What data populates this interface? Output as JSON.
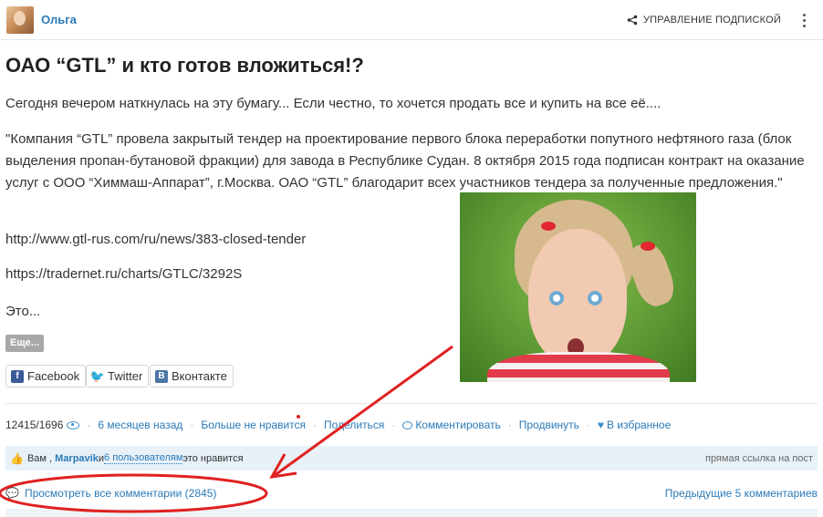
{
  "header": {
    "author_name": "Ольга",
    "subscription_label": "УПРАВЛЕНИЕ ПОДПИСКОЙ",
    "icons": {
      "share": "share-icon",
      "menu": "kebab-menu-icon"
    }
  },
  "post": {
    "title": "ОАО “GTL” и кто  готов вложиться!?",
    "intro": "Сегодня вечером наткнулась на эту бумагу... Если честно, то хочется продать все и купить на все её....",
    "quote": "\"Компания “GTL” провела закрытый тендер на проектирование первого блока переработки попутного нефтяного газа (блок выделения пропан-бутановой фракции) для завода в Республике Судан. 8 октября 2015 года подписан контракт на оказание услуг с ООО “Химмаш-Аппарат”, г.Москва. ОАО “GTL” благодарит всех участников тендера за полученные предложения.\"",
    "link1": "http://www.gtl-rus.com/ru/news/383-closed-tender",
    "link2": "https://tradernet.ru/charts/GTLC/3292S",
    "ending": "Это...",
    "more_label": "Еще..."
  },
  "share": {
    "facebook": "Facebook",
    "twitter": "Twitter",
    "vkontakte": "Вконтакте"
  },
  "actions": {
    "views": "12415/1696",
    "time_ago": "6 месяцев назад",
    "unlike": "Больше не нравится",
    "share": "Поделиться",
    "comment": "Комментировать",
    "promote": "Продвинуть",
    "favorite": "В избранное"
  },
  "likes": {
    "you": "Вам ,",
    "user": "Marpavik",
    "and": " и ",
    "others": "6 пользователям",
    "suffix": " это нравится",
    "permalink": "прямая ссылка на пост"
  },
  "comments": {
    "view_all": "Просмотреть все комментарии (2845)",
    "previous": "Предыдущие 5 комментариев"
  },
  "colors": {
    "link_blue": "#2a7ab8",
    "annotation_red": "#e02020",
    "likes_bg": "#e8f1f8"
  }
}
